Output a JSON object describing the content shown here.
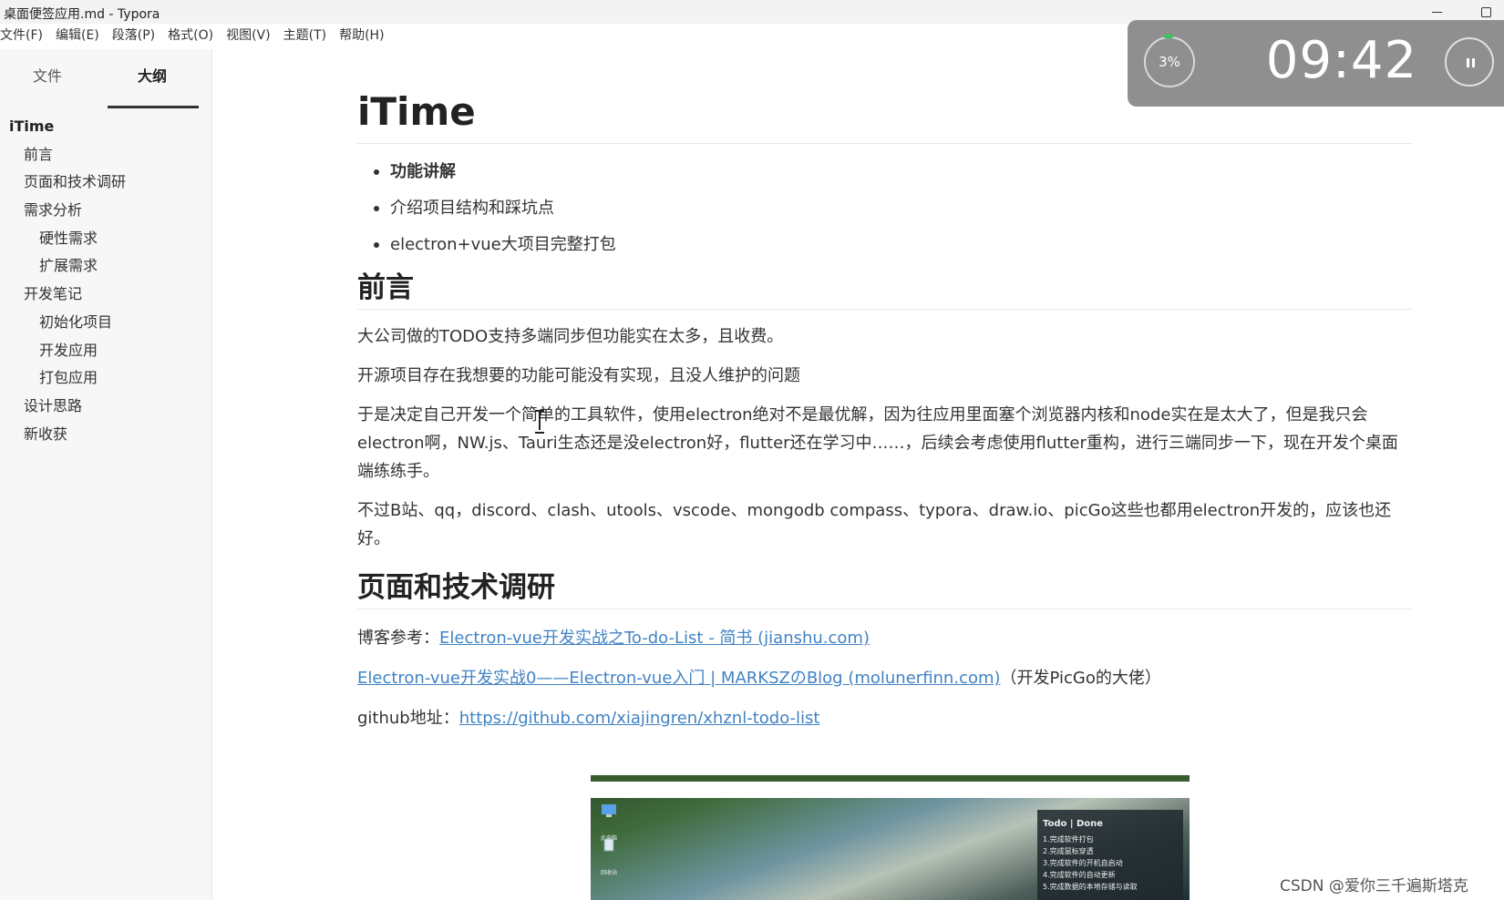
{
  "window": {
    "title": "桌面便签应用.md - Typora"
  },
  "menubar": {
    "items": [
      "文件(F)",
      "编辑(E)",
      "段落(P)",
      "格式(O)",
      "视图(V)",
      "主题(T)",
      "帮助(H)"
    ]
  },
  "sidebar": {
    "tabs": [
      "文件",
      "大纲"
    ],
    "active_tab": "大纲",
    "outline": [
      {
        "label": "iTime",
        "level": 1
      },
      {
        "label": "前言",
        "level": 2
      },
      {
        "label": "页面和技术调研",
        "level": 2
      },
      {
        "label": "需求分析",
        "level": 2
      },
      {
        "label": "硬性需求",
        "level": 3
      },
      {
        "label": "扩展需求",
        "level": 3
      },
      {
        "label": "开发笔记",
        "level": 2
      },
      {
        "label": "初始化项目",
        "level": 3
      },
      {
        "label": "开发应用",
        "level": 3
      },
      {
        "label": "打包应用",
        "level": 3
      },
      {
        "label": "设计思路",
        "level": 2
      },
      {
        "label": "新收获",
        "level": 2
      }
    ]
  },
  "document": {
    "h1": "iTime",
    "bullets": [
      "功能讲解",
      "介绍项目结构和踩坑点",
      "electron+vue大项目完整打包"
    ],
    "section1": {
      "heading": "前言",
      "p1": "大公司做的TODO支持多端同步但功能实在太多，且收费。",
      "p2": "开源项目存在我想要的功能可能没有实现，且没人维护的问题",
      "p3": "于是决定自己开发一个简单的工具软件，使用electron绝对不是最优解，因为往应用里面塞个浏览器内核和node实在是太大了，但是我只会electron啊，NW.js、Tauri生态还是没electron好，flutter还在学习中……，后续会考虑使用flutter重构，进行三端同步一下，现在开发个桌面端练练手。",
      "p4": "不过B站、qq，discord、clash、utools、vscode、mongodb compass、typora、draw.io、picGo这些也都用electron开发的，应该也还好。"
    },
    "section2": {
      "heading": "页面和技术调研",
      "blog_prefix": "博客参考：",
      "blog_link": "Electron-vue开发实战之To-do-List - 简书 (jianshu.com)",
      "link2": "Electron-vue开发实战0——Electron-vue入门 | MARKSZのBlog (molunerfinn.com)",
      "link2_suffix": "（开发PicGo的大佬）",
      "github_prefix": "github地址：",
      "github_link": "https://github.com/xiajingren/xhznl-todo-list"
    },
    "embedded_image": {
      "desk_icons": [
        "此电脑",
        "回收站"
      ],
      "todo_title": "Todo | Done",
      "todo_items": [
        "1.完成软件打包",
        "2.完成鼠标穿透",
        "3.完成软件的开机自启动",
        "4.完成软件的自动更新",
        "5.完成数据的本地存储与读取"
      ]
    }
  },
  "timer": {
    "percent": "3%",
    "time": "09:42",
    "progress_fraction": 0.03
  },
  "watermark": "CSDN @爱你三千遍斯塔克"
}
